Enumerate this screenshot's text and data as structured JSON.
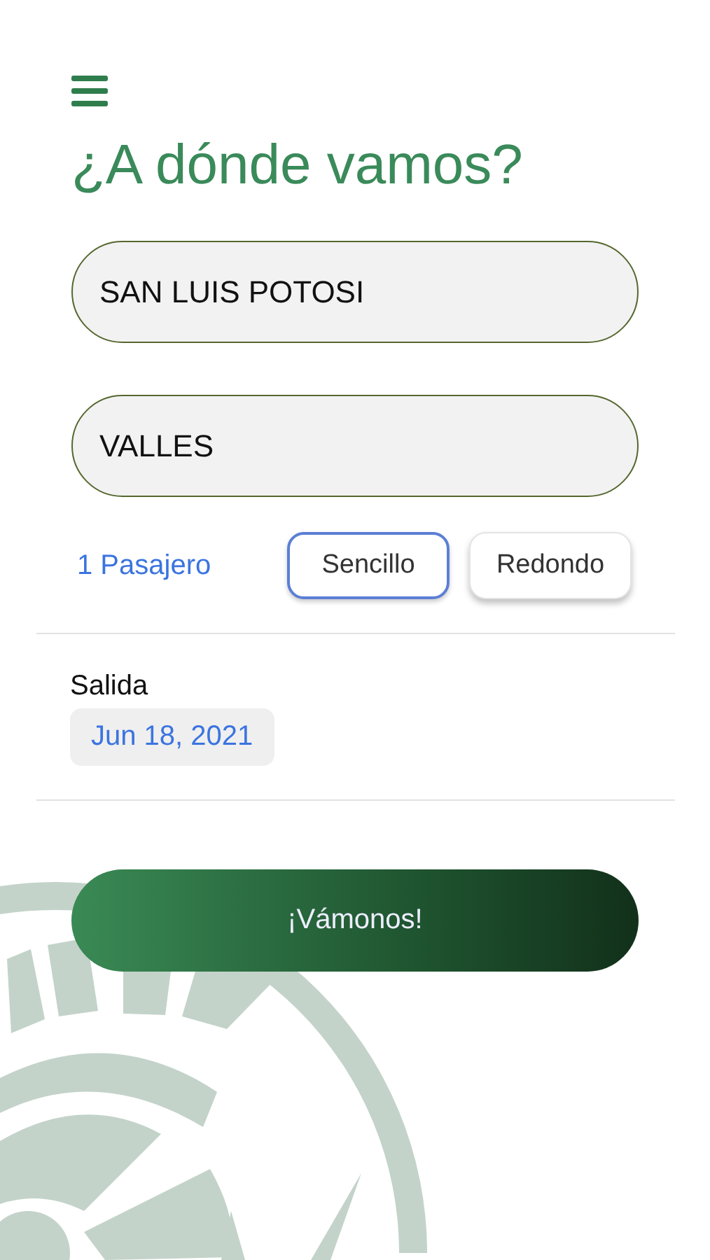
{
  "title": "¿A dónde vamos?",
  "origin": {
    "value": "SAN LUIS POTOSI"
  },
  "destination": {
    "value": "VALLES"
  },
  "passengers": "1 Pasajero",
  "trip_types": [
    {
      "label": "Sencillo",
      "selected": true
    },
    {
      "label": "Redondo",
      "selected": false
    }
  ],
  "departure": {
    "label": "Salida",
    "date": "Jun 18, 2021"
  },
  "submit": "¡Vámonos!"
}
